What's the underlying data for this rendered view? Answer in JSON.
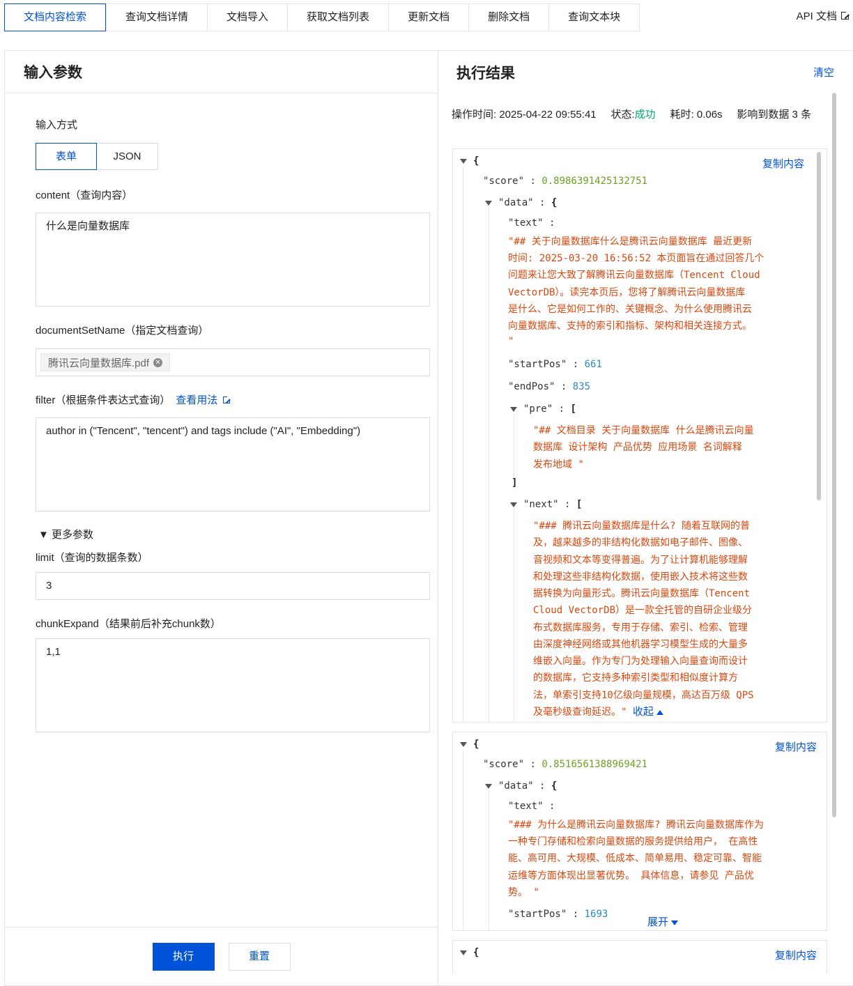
{
  "tabs": [
    "文档内容检索",
    "查询文档详情",
    "文档导入",
    "获取文档列表",
    "更新文档",
    "删除文档",
    "查询文本块"
  ],
  "api_doc_label": "API 文档",
  "left": {
    "title": "输入参数",
    "input_mode_label": "输入方式",
    "mode_form": "表单",
    "mode_json": "JSON",
    "content_label": "content（查询内容）",
    "content_value": "什么是向量数据库",
    "docset_label": "documentSetName（指定文档查询）",
    "docset_tag": "腾讯云向量数据库.pdf",
    "filter_label": "filter（根据条件表达式查询）",
    "filter_link": "查看用法",
    "filter_value": "author in (\"Tencent\", \"tencent\") and tags include (\"AI\", \"Embedding\")",
    "more_params": "▼ 更多参数",
    "limit_label": "limit（查询的数据条数）",
    "limit_value": "3",
    "chunk_label": "chunkExpand（结果前后补充chunk数）",
    "chunk_value": "1,1",
    "run_button": "执行",
    "reset_button": "重置"
  },
  "right": {
    "title": "执行结果",
    "clear": "清空",
    "meta_time_label": "操作时间: ",
    "meta_time": "2025-04-22 09:55:41",
    "meta_status_label": "状态:",
    "meta_status": "成功",
    "meta_cost": "耗时: 0.06s",
    "meta_affected": "影响到数据 3 条",
    "copy": "复制内容",
    "collapse": "收起",
    "expand": "展开",
    "results": [
      {
        "score": "0.8986391425132751",
        "text_lines": [
          "\"## 关于向量数据库什么是腾讯云向量数据库 最近更新",
          "时间: 2025-03-20 16:56:52 本页面旨在通过回答几个",
          "问题来让您大致了解腾讯云向量数据库（Tencent Cloud",
          "VectorDB）。读完本页后，您将了解腾讯云向量数据库",
          "是什么、它是如何工作的、关键概念、为什么使用腾讯云",
          "向量数据库、支持的索引和指标、架构和相关连接方式。",
          "\""
        ],
        "startPos": "661",
        "endPos": "835",
        "pre_lines": [
          "\"## 文档目录 关于向量数据库 什么是腾讯云向量",
          "数据库 设计架构 产品优势 应用场景 名词解释",
          "发布地域 \""
        ],
        "next_lines": [
          "\"### 腾讯云向量数据库是什么? 随着互联网的普",
          "及，越来越多的非结构化数据如电子邮件、图像、",
          "音视频和文本等变得普遍。为了让计算机能够理解",
          "和处理这些非结构化数据，使用嵌入技术将这些数",
          "据转换为向量形式。腾讯云向量数据库（Tencent",
          "Cloud VectorDB）是一款全托管的自研企业级分",
          "布式数据库服务，专用于存储、索引、检索、管理",
          "由深度神经网络或其他机器学习模型生成的大量多",
          "维嵌入向量。作为专门为处理输入向量查询而设计",
          "的数据库，它支持多种索引类型和相似度计算方",
          "法，单索引支持10亿级向量规模，高达百万级 QPS",
          "及毫秒级查询延迟。\""
        ]
      },
      {
        "score": "0.8516561388969421",
        "text_lines": [
          "\"### 为什么是腾讯云向量数据库? 腾讯云向量数据库作为",
          "一种专门存储和检索向量数据的服务提供给用户， 在高性",
          "能、高可用、大规模、低成本、简单易用、稳定可靠、智能",
          "运维等方面体现出显著优势。 具体信息，请参见 产品优",
          "势。 \""
        ],
        "startPos": "1693"
      }
    ]
  }
}
